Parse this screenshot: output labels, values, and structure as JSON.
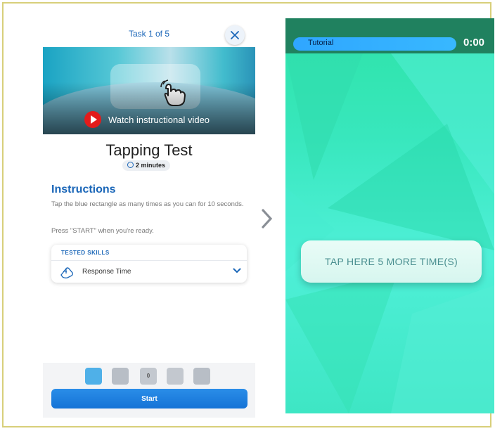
{
  "left_screen": {
    "task_counter": "Task 1 of 5",
    "video_label": "Watch instructional video",
    "test_title": "Tapping Test",
    "duration": "2 minutes",
    "instructions_heading": "Instructions",
    "instructions_text": "Tap the blue rectangle as many times as you can for 10 seconds.",
    "instructions_ready": "Press \"START\" when you're ready.",
    "skills": {
      "heading": "TESTED SKILLS",
      "items": [
        {
          "label": "Response Time",
          "icon": "tap-hand-icon"
        }
      ]
    },
    "thumbnails": [
      {
        "name": "thumb-tapping",
        "text": "",
        "color": "#4fb0e8"
      },
      {
        "name": "thumb-2",
        "text": "",
        "color": "#b8bec6"
      },
      {
        "name": "thumb-3",
        "text": "0",
        "color": "#c3c8cf"
      },
      {
        "name": "thumb-4",
        "text": "",
        "color": "#c3c8cf"
      },
      {
        "name": "thumb-5",
        "text": "",
        "color": "#b8bec6"
      }
    ],
    "start_label": "Start"
  },
  "right_screen": {
    "tutorial_label": "Tutorial",
    "timer": "0:00",
    "tap_button": "TAP HERE 5 MORE TIME(S)"
  },
  "colors": {
    "accent_blue": "#1a66b8",
    "start_blue": "#1f80e0",
    "game_green": "#3ee6c4",
    "topbar_green": "#20815f",
    "play_red": "#e31b1b"
  }
}
